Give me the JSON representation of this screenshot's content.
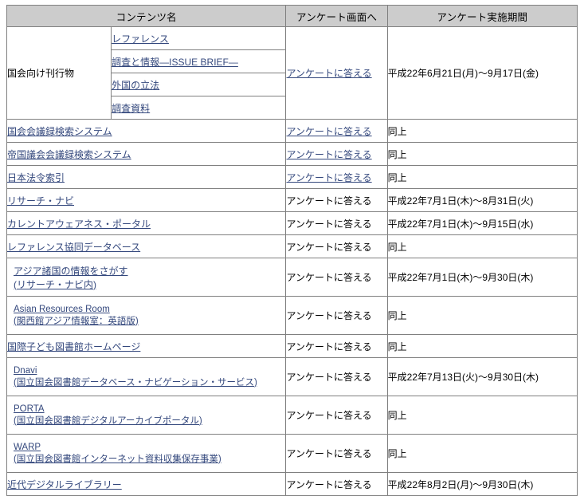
{
  "table": {
    "headers": {
      "content_name": "コンテンツ名",
      "survey_link": "アンケート画面へ",
      "survey_period": "アンケート実施期間"
    },
    "answer_label": "アンケートに答える",
    "same_as_above": "同上",
    "colors": {
      "header_background": "#cccccc",
      "link": "#34487d",
      "border": "#808080",
      "text": "#000000",
      "page_background": "#ffffff"
    },
    "rows": [
      {
        "group_label": "国会向け刊行物",
        "sub_items": [
          "レファレンス",
          "調査と情報―ISSUE BRIEF―",
          "外国の立法",
          "調査資料"
        ],
        "answer": "アンケートに答える",
        "answer_is_link": true,
        "period": "平成22年6月21日(月)〜9月17日(金)"
      },
      {
        "name": "国会会議録検索システム",
        "name_is_link": true,
        "answer": "アンケートに答える",
        "answer_is_link": true,
        "period": "同上"
      },
      {
        "name": "帝国議会会議録検索システム",
        "name_is_link": true,
        "answer": "アンケートに答える",
        "answer_is_link": true,
        "period": "同上"
      },
      {
        "name": "日本法令索引",
        "name_is_link": true,
        "answer": "アンケートに答える",
        "answer_is_link": true,
        "period": "同上"
      },
      {
        "name": "リサーチ・ナビ",
        "name_is_link": true,
        "answer": "アンケートに答える",
        "answer_is_link": false,
        "period": "平成22年7月1日(木)〜8月31日(火)"
      },
      {
        "name": "カレントアウェアネス・ポータル",
        "name_is_link": true,
        "answer": "アンケートに答える",
        "answer_is_link": false,
        "period": "平成22年7月1日(木)〜9月15日(水)"
      },
      {
        "name": "レファレンス協同データベース",
        "name_is_link": true,
        "answer": "アンケートに答える",
        "answer_is_link": false,
        "period": "同上"
      },
      {
        "name": "アジア諸国の情報をさがす",
        "name_line2": "(リサーチ・ナビ内)",
        "name_is_link": true,
        "answer": "アンケートに答える",
        "answer_is_link": false,
        "period": "平成22年7月1日(木)〜9月30日(木)"
      },
      {
        "name": "Asian Resources Room",
        "name_line2": "(関西館アジア情報室：英語版)",
        "name_is_link": true,
        "answer": "アンケートに答える",
        "answer_is_link": false,
        "period": "同上"
      },
      {
        "name": "国際子ども図書館ホームページ",
        "name_is_link": true,
        "answer": "アンケートに答える",
        "answer_is_link": false,
        "period": "同上"
      },
      {
        "name": "Dnavi",
        "name_line2": "(国立国会図書館データベース・ナビゲーション・サービス)",
        "name_is_link": true,
        "answer": "アンケートに答える",
        "answer_is_link": false,
        "period": "平成22年7月13日(火)〜9月30日(木)"
      },
      {
        "name": "PORTA",
        "name_line2": "(国立国会図書館デジタルアーカイブポータル)",
        "name_is_link": true,
        "answer": "アンケートに答える",
        "answer_is_link": false,
        "period": "同上"
      },
      {
        "name": "WARP",
        "name_line2": "(国立国会図書館インターネット資料収集保存事業)",
        "name_is_link": true,
        "answer": "アンケートに答える",
        "answer_is_link": false,
        "period": "同上"
      },
      {
        "name": "近代デジタルライブラリー",
        "name_is_link": true,
        "answer": "アンケートに答える",
        "answer_is_link": false,
        "period": "平成22年8月2日(月)〜9月30日(木)"
      }
    ]
  }
}
